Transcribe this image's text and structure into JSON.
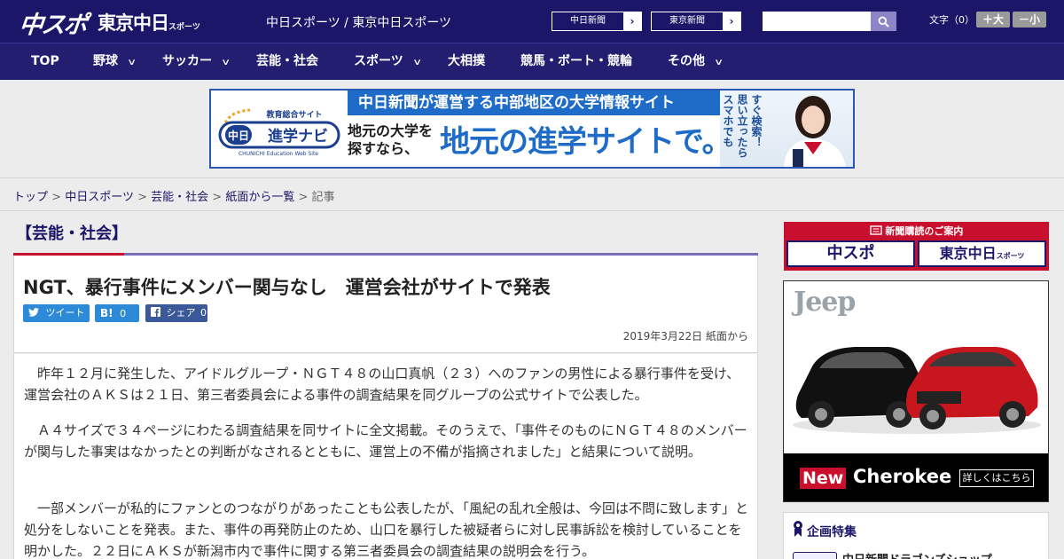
{
  "header": {
    "logo_chuspo": "中スポ",
    "logo_tokyo": "東京中日",
    "logo_tokyo_small": "スポーツ",
    "site_links": "中日スポーツ / 東京中日スポーツ",
    "ext_links": [
      {
        "label": "中日新聞",
        "arrow": "›"
      },
      {
        "label": "東京新聞",
        "arrow": "›"
      }
    ],
    "search": {
      "placeholder": "",
      "value": ""
    },
    "font_size": {
      "label": "文字（0）",
      "bigger": "＋大",
      "smaller": "－小"
    }
  },
  "nav": {
    "items": [
      {
        "label": "TOP",
        "dropdown": false
      },
      {
        "label": "野球",
        "dropdown": true
      },
      {
        "label": "サッカー",
        "dropdown": true
      },
      {
        "label": "芸能・社会",
        "dropdown": false
      },
      {
        "label": "スポーツ",
        "dropdown": true
      },
      {
        "label": "大相撲",
        "dropdown": false
      },
      {
        "label": "競馬・ボート・競輪",
        "dropdown": false
      },
      {
        "label": "その他",
        "dropdown": true
      }
    ],
    "chevron": "∨"
  },
  "banner": {
    "logo_top": "教育総合サイト",
    "logo_main": "中日進学ナビ",
    "logo_sub": "CHUNICHI Education Web Site",
    "headline": "中日新聞が運営する中部地区の大学情報サイト",
    "sub_line1": "地元の大学を",
    "sub_line2": "探すなら、",
    "big_text": "地元の進学サイトで。",
    "vertical_lines": [
      "スマホでも",
      "思い立ったら",
      "すぐ検索！"
    ]
  },
  "breadcrumb": {
    "items": [
      "トップ",
      "中日スポーツ",
      "芸能・社会",
      "紙面から一覧"
    ],
    "current": "記事",
    "separator": ">"
  },
  "article": {
    "category": "【芸能・社会】",
    "headline": "NGT、暴行事件にメンバー関与なし　運営会社がサイトで発表",
    "share": {
      "twitter": "ツイート",
      "hatena_label": "B!",
      "hatena_count": "0",
      "facebook_label": "シェア",
      "facebook_count": "0"
    },
    "date": "2019年3月22日 紙面から",
    "paragraphs": [
      "昨年１２月に発生した、アイドルグループ・ＮＧＴ４８の山口真帆（２３）へのファンの男性による暴行事件を受け、運営会社のＡＫＳは２１日、第三者委員会による事件の調査結果を同グループの公式サイトで公表した。",
      "Ａ４サイズで３４ページにわたる調査結果を同サイトに全文掲載。そのうえで、「事件そのものにＮＧＴ４８のメンバーが関与した事実はなかったとの判断がなされるとともに、運営上の不備が指摘されました」と結果について説明。",
      "一部メンバーが私的にファンとのつながりがあったことも公表したが、「風紀の乱れ全般は、今回は不問に致します」と処分をしないことを発表。また、事件の再発防止のため、山口を暴行した被疑者らに対し民事訴訟を検討していることを明かした。２２日にＡＫＳが新潟市内で事件に関する第三者委員会の調査結果の説明会を行う。"
    ]
  },
  "sidebar": {
    "subscription_title": "新聞購読のご案内",
    "subscription_logos": [
      "中スポ",
      "東京中日"
    ],
    "subscription_logo_small": "スポーツ",
    "jeep_ad": {
      "brand": "Jeep",
      "new_badge": "New",
      "model": "Cherokee",
      "cta": "詳しくはこちら"
    },
    "feature_title": "企画特集",
    "feature_item": "中日新聞ドラゴンズショップ"
  },
  "colors": {
    "header_bg": "#1b1668",
    "nav_bg": "#231e70",
    "accent_red": "#c8102e",
    "share_blue": "#2d8ad8"
  }
}
